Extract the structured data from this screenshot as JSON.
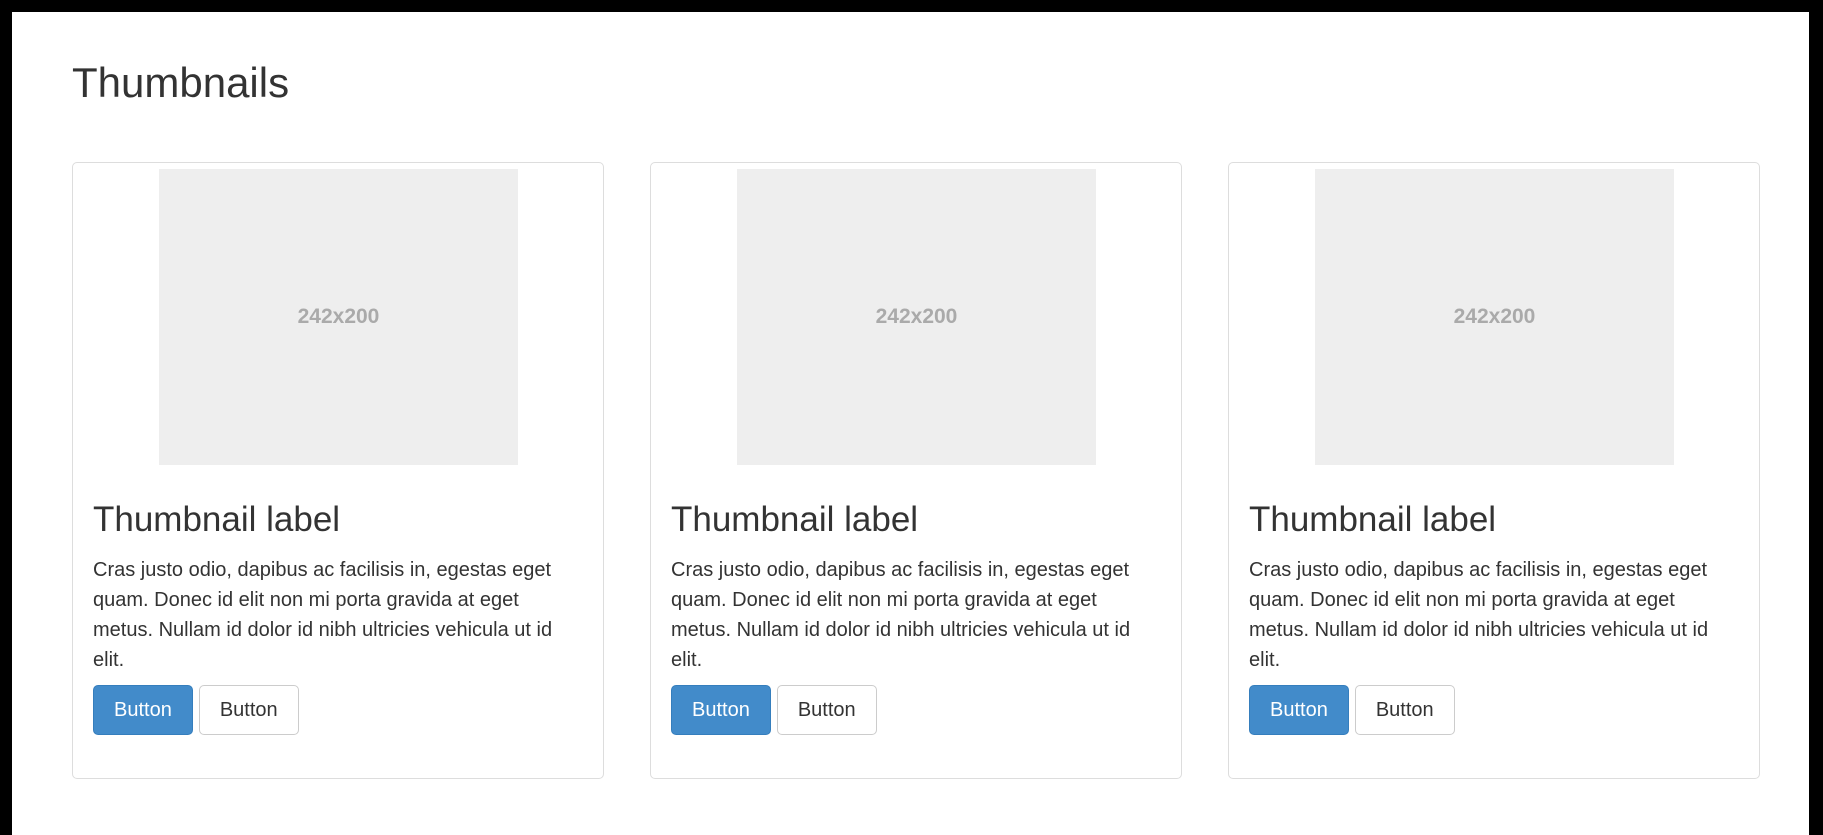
{
  "page": {
    "title": "Thumbnails"
  },
  "thumbnails": [
    {
      "placeholder": "242x200",
      "label": "Thumbnail label",
      "text": "Cras justo odio, dapibus ac facilisis in, egestas eget quam. Donec id elit non mi porta gravida at eget metus. Nullam id dolor id nibh ultricies vehicula ut id elit.",
      "primary_button": "Button",
      "default_button": "Button"
    },
    {
      "placeholder": "242x200",
      "label": "Thumbnail label",
      "text": "Cras justo odio, dapibus ac facilisis in, egestas eget quam. Donec id elit non mi porta gravida at eget metus. Nullam id dolor id nibh ultricies vehicula ut id elit.",
      "primary_button": "Button",
      "default_button": "Button"
    },
    {
      "placeholder": "242x200",
      "label": "Thumbnail label",
      "text": "Cras justo odio, dapibus ac facilisis in, egestas eget quam. Donec id elit non mi porta gravida at eget metus. Nullam id dolor id nibh ultricies vehicula ut id elit.",
      "primary_button": "Button",
      "default_button": "Button"
    }
  ],
  "colors": {
    "primary": "#428bca",
    "placeholder_bg": "#eeeeee",
    "border": "#dddddd"
  }
}
